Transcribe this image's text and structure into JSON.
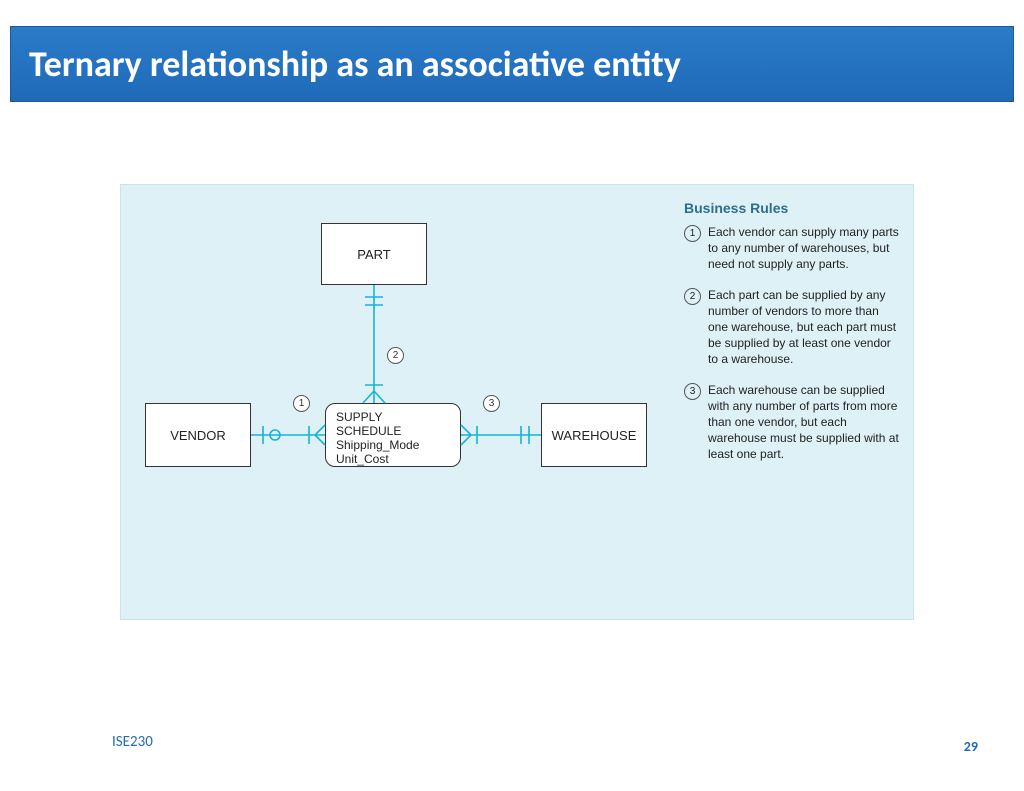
{
  "header": {
    "title": "Ternary relationship as an associative entity"
  },
  "diagram": {
    "entities": {
      "part": "PART",
      "vendor": "VENDOR",
      "warehouse": "WAREHOUSE"
    },
    "associative": {
      "name": "SUPPLY SCHEDULE",
      "attrs": [
        "Shipping_Mode",
        "Unit_Cost"
      ]
    },
    "markers": {
      "m1": "1",
      "m2": "2",
      "m3": "3"
    },
    "rules_title": "Business Rules",
    "rules": [
      {
        "n": "1",
        "text": "Each vendor can supply many parts to any number of warehouses, but need not supply any parts."
      },
      {
        "n": "2",
        "text": "Each part can be supplied by any number of vendors to more than one warehouse, but each part must be supplied by at least one vendor to a warehouse."
      },
      {
        "n": "3",
        "text": "Each warehouse can be supplied with any number of parts from more than one vendor, but each warehouse must be supplied with at least one part."
      }
    ]
  },
  "footer": {
    "course": "ISE230",
    "page": "29"
  }
}
